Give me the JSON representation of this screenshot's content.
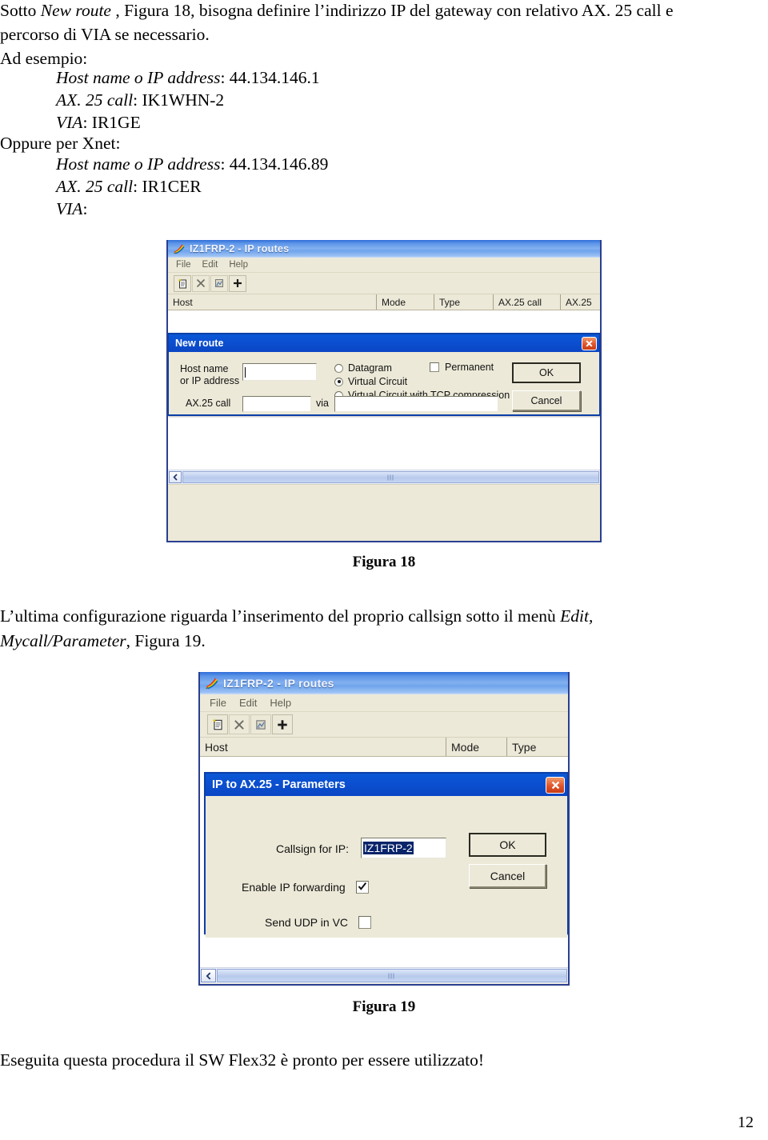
{
  "document": {
    "paragraphs": [
      {
        "id": "intro",
        "runs": [
          {
            "t": "Sotto ",
            "style": "normal"
          },
          {
            "t": "New route",
            "style": "italic"
          },
          {
            "t": " , Figura 18,  bisogna definire l’indirizzo IP del gateway con relativo AX. 25 call e percorso di VIA se necessario.",
            "style": "normal"
          }
        ]
      }
    ],
    "line_intro_1": "Sotto ",
    "line_intro_italic": "New route",
    "line_intro_2": " , Figura 18,  bisogna definire l’indirizzo IP del gateway con relativo AX. 25 call e",
    "line_intro_3": "percorso di VIA se necessario.",
    "ad_esempio": "Ad esempio:",
    "example1": {
      "host_label": "Host name o IP address",
      "host_value": ": 44.134.146.1",
      "call_label": "AX. 25 call",
      "call_value": ": IK1WHN-2",
      "via_label": "VIA",
      "via_value": ": IR1GE"
    },
    "oppure": "Oppure per Xnet:",
    "example2": {
      "host_label": "Host name o IP address",
      "host_value": ": 44.134.146.89",
      "call_label": "AX. 25 call",
      "call_value": ": IR1CER",
      "via_label": "VIA",
      "via_value": ":"
    },
    "fig18_caption": "Figura 18",
    "mid_text_1": "L’ultima configurazione riguarda l’inserimento del proprio callsign sotto il menù ",
    "mid_text_italic_1": "Edit,",
    "mid_text_italic_2": "Mycall/Parameter",
    "mid_text_2": ", Figura 19.",
    "fig19_caption": "Figura 19",
    "closing_text": "Eseguita questa procedura il SW Flex32 è pronto per essere utilizzato!",
    "page_number": "12"
  },
  "figure18": {
    "window": {
      "title": "IZ1FRP-2 - IP routes",
      "icon": "rainbow-feather-icon",
      "menu": [
        "File",
        "Edit",
        "Help"
      ],
      "toolbar": [
        {
          "name": "new-route-icon",
          "label": "New"
        },
        {
          "name": "delete-route-icon",
          "label": "Delete"
        },
        {
          "name": "edit-route-icon",
          "label": "Edit"
        },
        {
          "name": "add-route-icon",
          "label": "Add"
        }
      ],
      "columns": [
        "Host",
        "Mode",
        "Type",
        "AX.25 call",
        "AX.25"
      ]
    },
    "dialog": {
      "title": "New route",
      "close_label": "✕",
      "host_label_line1": "Host name",
      "host_label_line2": "or IP address",
      "host_value": "",
      "call_label": "AX.25 call",
      "call_value": "",
      "via_label": "via",
      "via_value": "",
      "radios": [
        {
          "label": "Datagram",
          "selected": false
        },
        {
          "label": "Virtual Circuit",
          "selected": true
        },
        {
          "label": "Virtual Circuit with TCP compression",
          "selected": false
        }
      ],
      "permanent_label": "Permanent",
      "permanent_checked": false,
      "ok_label": "OK",
      "cancel_label": "Cancel"
    }
  },
  "figure19": {
    "window": {
      "title": "IZ1FRP-2 - IP routes",
      "icon": "rainbow-feather-icon",
      "menu": [
        "File",
        "Edit",
        "Help"
      ],
      "toolbar": [
        {
          "name": "new-route-icon",
          "label": "New"
        },
        {
          "name": "delete-route-icon",
          "label": "Delete"
        },
        {
          "name": "edit-route-icon",
          "label": "Edit"
        },
        {
          "name": "add-route-icon",
          "label": "Add"
        }
      ],
      "columns": [
        "Host",
        "Mode",
        "Type"
      ]
    },
    "dialog": {
      "title": "IP to AX.25 - Parameters",
      "close_label": "✕",
      "callsign_label": "Callsign for IP:",
      "callsign_value": "IZ1FRP-2",
      "forwarding_label": "Enable IP forwarding",
      "forwarding_checked": true,
      "udp_label": "Send UDP in VC",
      "udp_checked": false,
      "ok_label": "OK",
      "cancel_label": "Cancel"
    }
  },
  "colors": {
    "title_blue": "#0a4fd0",
    "window_face": "#ece9d8",
    "frame_blue": "#2a3f8f",
    "close_red": "#e0552c",
    "selection_blue": "#0a246a"
  }
}
